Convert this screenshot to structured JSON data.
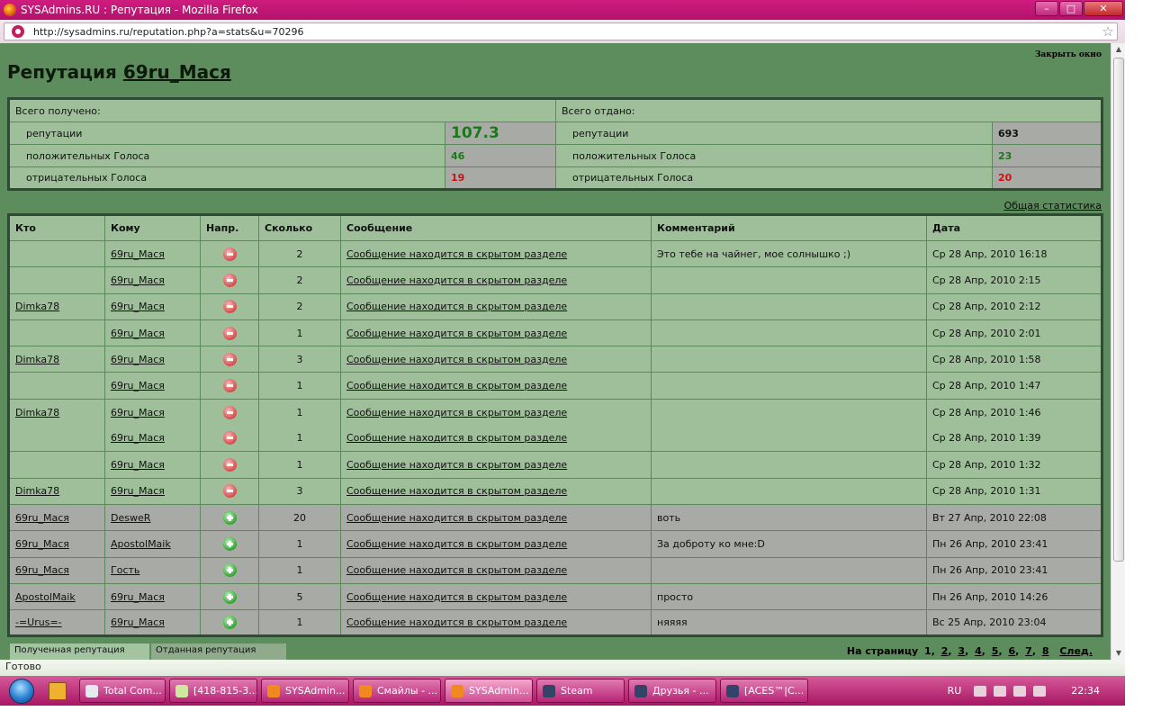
{
  "window": {
    "title": "SYSAdmins.RU : Репутация - Mozilla Firefox",
    "min": "–",
    "max": "□",
    "close": "✕"
  },
  "browser": {
    "url": "http://sysadmins.ru/reputation.php?a=stats&u=70296",
    "star": "☆"
  },
  "page": {
    "title_prefix": "Репутация",
    "user": "69ru_Мася",
    "close_window": "Закрыть окно",
    "general_stats": "Общая статистика"
  },
  "stats": {
    "received": {
      "header": "Всего получено:",
      "rep_label": "репутации",
      "rep_value": "107.3",
      "pos_label": "положительных Голоса",
      "pos_value": "46",
      "neg_label": "отрицательных Голоса",
      "neg_value": "19"
    },
    "given": {
      "header": "Всего отдано:",
      "rep_label": "репутации",
      "rep_value": "693",
      "pos_label": "положительных Голоса",
      "pos_value": "23",
      "neg_label": "отрицательных Голоса",
      "neg_value": "20"
    }
  },
  "table": {
    "headers": [
      "Кто",
      "Кому",
      "Напр.",
      "Сколько",
      "Сообщение",
      "Комментарий",
      "Дата"
    ],
    "rows": [
      {
        "who": "",
        "to": "69ru_Мася",
        "dir": "minus",
        "amount": "2",
        "message": "Сообщение находится в скрытом разделе",
        "comment": "Это тебе на чайнег, мое солнышко ;)",
        "date": "Ср 28 Апр, 2010 16:18"
      },
      {
        "who": "",
        "to": "69ru_Мася",
        "dir": "minus",
        "amount": "2",
        "message": "Сообщение находится в скрытом разделе",
        "comment": "",
        "date": "Ср 28 Апр, 2010 2:15"
      },
      {
        "who": "Dimka78",
        "to": "69ru_Мася",
        "dir": "minus",
        "amount": "2",
        "message": "Сообщение находится в скрытом разделе",
        "comment": "",
        "date": "Ср 28 Апр, 2010 2:12"
      },
      {
        "who": "",
        "to": "69ru_Мася",
        "dir": "minus",
        "amount": "1",
        "message": "Сообщение находится в скрытом разделе",
        "comment": "",
        "date": "Ср 28 Апр, 2010 2:01"
      },
      {
        "who": "Dimka78",
        "to": "69ru_Мася",
        "dir": "minus",
        "amount": "3",
        "message": "Сообщение находится в скрытом разделе",
        "comment": "",
        "date": "Ср 28 Апр, 2010 1:58"
      },
      {
        "who": "",
        "to": "69ru_Мася",
        "dir": "minus",
        "amount": "1",
        "message": "Сообщение находится в скрытом разделе",
        "comment": "",
        "date": "Ср 28 Апр, 2010 1:47"
      },
      {
        "who": "Dimka78",
        "to": "69ru_Мася",
        "dir": "minus",
        "amount": "1",
        "message": "Сообщение находится в скрытом разделе",
        "comment": "",
        "date": "Ср 28 Апр, 2010 1:46"
      },
      {
        "who": "",
        "to": "69ru_Мася",
        "dir": "minus",
        "amount": "1",
        "message": "Сообщение находится в скрытом разделе",
        "comment": "",
        "date": "Ср 28 Апр, 2010 1:39"
      },
      {
        "who": "",
        "to": "69ru_Мася",
        "dir": "minus",
        "amount": "1",
        "message": "Сообщение находится в скрытом разделе",
        "comment": "",
        "date": "Ср 28 Апр, 2010 1:32"
      },
      {
        "who": "Dimka78",
        "to": "69ru_Мася",
        "dir": "minus",
        "amount": "3",
        "message": "Сообщение находится в скрытом разделе",
        "comment": "",
        "date": "Ср 28 Апр, 2010 1:31"
      },
      {
        "who": "69ru_Мася",
        "to": "DesweR",
        "dir": "plus",
        "amount": "20",
        "message": "Сообщение находится в скрытом разделе",
        "comment": "воть",
        "date": "Вт 27 Апр, 2010 22:08"
      },
      {
        "who": "69ru_Мася",
        "to": "ApostolMaik",
        "dir": "plus",
        "amount": "1",
        "message": "Сообщение находится в скрытом разделе",
        "comment": "За доброту ко мне:D",
        "date": "Пн 26 Апр, 2010 23:41"
      },
      {
        "who": "69ru_Мася",
        "to": "Гость",
        "dir": "plus",
        "amount": "1",
        "message": "Сообщение находится в скрытом разделе",
        "comment": "",
        "date": "Пн 26 Апр, 2010 23:41"
      },
      {
        "who": "ApostolMaik",
        "to": "69ru_Мася",
        "dir": "plus",
        "amount": "5",
        "message": "Сообщение находится в скрытом разделе",
        "comment": "просто",
        "date": "Пн 26 Апр, 2010 14:26"
      },
      {
        "who": "-=Urus=-",
        "to": "69ru_Мася",
        "dir": "plus",
        "amount": "1",
        "message": "Сообщение находится в скрытом разделе",
        "comment": "няяяя",
        "date": "Вс 25 Апр, 2010 23:04"
      }
    ]
  },
  "tabs": {
    "received": "Полученная репутация",
    "given": "Отданная репутация"
  },
  "pager": {
    "label": "На страницу",
    "current": "1",
    "pages": [
      "2",
      "3",
      "4",
      "5",
      "6",
      "7",
      "8"
    ],
    "next": "След."
  },
  "status": "Готово",
  "taskbar": {
    "items": [
      {
        "label": "Total Com...",
        "color": "#e8e8f0"
      },
      {
        "label": "[418-815-3...",
        "color": "#cfe8a0"
      },
      {
        "label": "SYSAdmin...",
        "color": "#f08a20"
      },
      {
        "label": "Смайлы - ...",
        "color": "#f08a20"
      },
      {
        "label": "SYSAdmin...",
        "color": "#f08a20",
        "active": true
      },
      {
        "label": "Steam",
        "color": "#334466"
      },
      {
        "label": "Друзья - ...",
        "color": "#334466"
      },
      {
        "label": "[ACES™|C...",
        "color": "#334466"
      }
    ],
    "lang": "RU",
    "clock": "22:34"
  }
}
